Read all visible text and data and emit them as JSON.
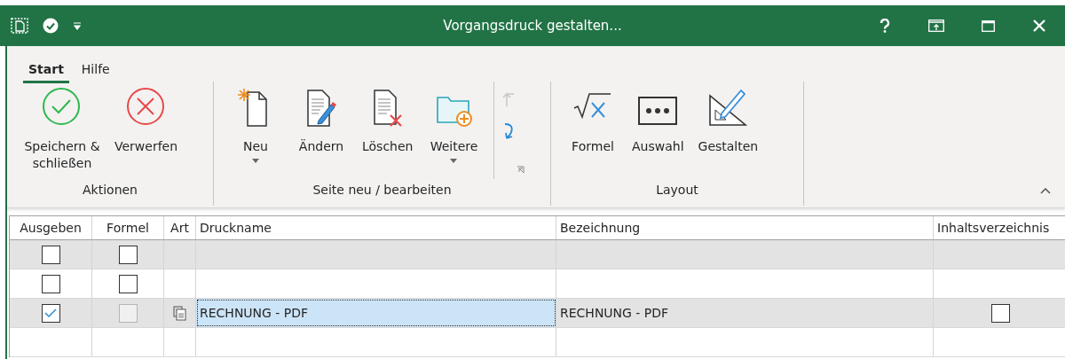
{
  "window": {
    "title": "Vorgangsdruck gestalten..."
  },
  "ribbon": {
    "tabs": [
      {
        "label": "Start",
        "selected": true
      },
      {
        "label": "Hilfe",
        "selected": false
      }
    ],
    "groups": [
      {
        "label": "Aktionen",
        "buttons": [
          {
            "kind": "save",
            "label": "Speichern & schließen"
          },
          {
            "kind": "discard",
            "label": "Verwerfen"
          }
        ]
      },
      {
        "label": "Seite neu / bearbeiten",
        "launcher": true,
        "buttons": [
          {
            "kind": "new",
            "label": "Neu",
            "dropdown": true
          },
          {
            "kind": "edit",
            "label": "Ändern"
          },
          {
            "kind": "delete",
            "label": "Löschen"
          },
          {
            "kind": "more",
            "label": "Weitere",
            "dropdown": true
          }
        ],
        "small_buttons": [
          {
            "kind": "up",
            "disabled": true
          },
          {
            "kind": "down",
            "disabled": false
          }
        ]
      },
      {
        "label": "Layout",
        "buttons": [
          {
            "kind": "formula",
            "label": "Formel"
          },
          {
            "kind": "select",
            "label": "Auswahl"
          },
          {
            "kind": "design",
            "label": "Gestalten"
          }
        ]
      }
    ]
  },
  "table": {
    "columns": [
      "Ausgeben",
      "Formel",
      "Art",
      "Druckname",
      "Bezeichnung",
      "Inhaltsverzeichnis"
    ],
    "rows": [
      {
        "selected": false,
        "ausgeben": {
          "checked": false
        },
        "formel": {
          "checked": false,
          "disabled": false
        }
      },
      {
        "selected": false,
        "ausgeben": {
          "checked": false
        },
        "formel": {
          "checked": false,
          "disabled": false
        }
      },
      {
        "selected": true,
        "ausgeben": {
          "checked": true
        },
        "formel": {
          "checked": false,
          "disabled": true
        },
        "art": {
          "kind": "document"
        },
        "druckname": "RECHNUNG - PDF",
        "bezeichnung": "RECHNUNG - PDF",
        "inhaltsverzeichnis": {
          "checked": false
        }
      },
      {
        "selected": false
      }
    ]
  }
}
